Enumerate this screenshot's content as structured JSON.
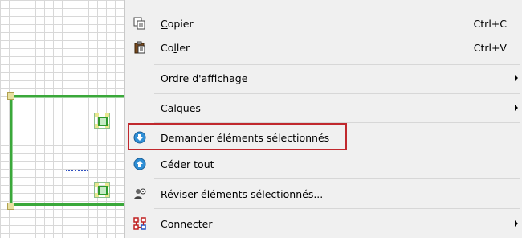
{
  "menu": {
    "items": [
      {
        "id": "copy",
        "label_pre": "",
        "label_mn": "C",
        "label_post": "opier",
        "shortcut": "Ctrl+C",
        "icon": "copy-icon"
      },
      {
        "id": "paste",
        "label_pre": "Co",
        "label_mn": "l",
        "label_post": "ler",
        "shortcut": "Ctrl+V",
        "icon": "paste-icon"
      },
      {
        "id": "display-order",
        "label": "Ordre d'affichage",
        "submenu": true
      },
      {
        "id": "layers",
        "label": "Calques",
        "submenu": true
      },
      {
        "id": "request-selected",
        "label": "Demander éléments sélectionnés",
        "icon": "arrow-down-circle-icon",
        "highlighted": true
      },
      {
        "id": "release-all",
        "label": "Céder tout",
        "icon": "arrow-up-circle-icon"
      },
      {
        "id": "review-selected",
        "label": "Réviser éléments sélectionnés...",
        "icon": "review-users-icon"
      },
      {
        "id": "connect",
        "label": "Connecter",
        "icon": "connect-icon",
        "submenu": true
      }
    ]
  },
  "colors": {
    "highlight_border": "#c0282d",
    "frame_green": "#3aa83a",
    "menu_bg": "#f0f0f0"
  }
}
